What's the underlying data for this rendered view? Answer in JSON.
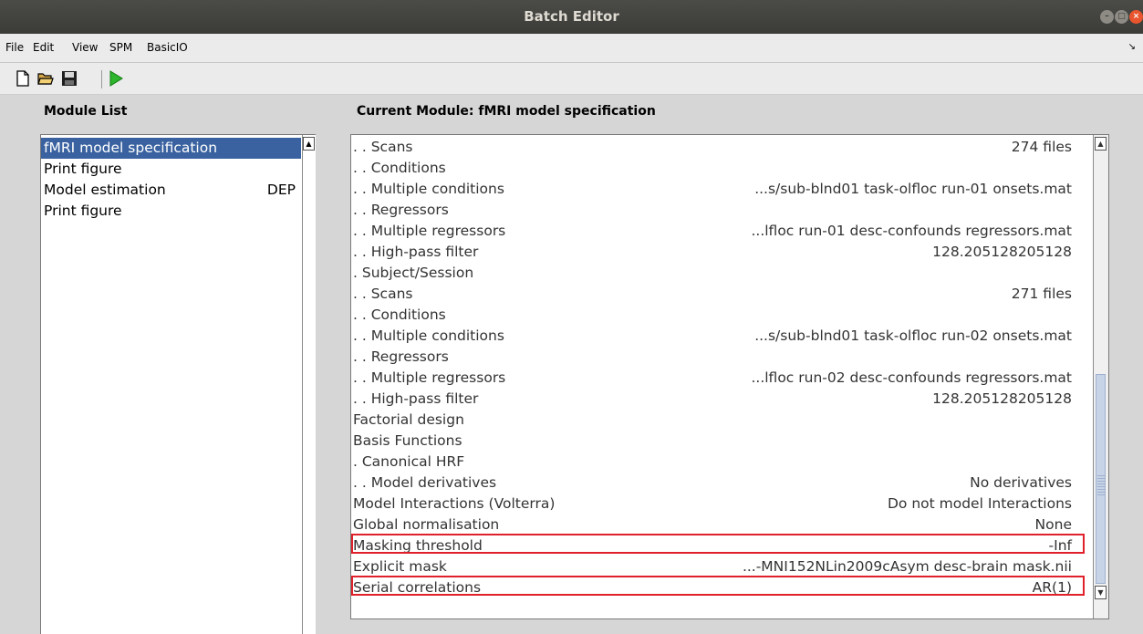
{
  "window": {
    "title": "Batch Editor"
  },
  "menu": {
    "file": "File",
    "edit": "Edit",
    "view": "View",
    "spm": "SPM",
    "basicio": "BasicIO"
  },
  "headers": {
    "module_list": "Module List",
    "current_module": "Current Module: fMRI model specification"
  },
  "module_list": [
    {
      "label": "fMRI model specification",
      "tag": "",
      "selected": true
    },
    {
      "label": "Print figure",
      "tag": ""
    },
    {
      "label": "Model estimation",
      "tag": "DEP"
    },
    {
      "label": "Print figure",
      "tag": ""
    }
  ],
  "current_module": [
    {
      "label": ". . Scans",
      "value": "274 files"
    },
    {
      "label": ". . Conditions",
      "value": ""
    },
    {
      "label": ". . Multiple conditions",
      "value": "...s/sub-blnd01 task-olfloc run-01 onsets.mat"
    },
    {
      "label": ". . Regressors",
      "value": ""
    },
    {
      "label": ". . Multiple regressors",
      "value": "...lfloc run-01 desc-confounds regressors.mat"
    },
    {
      "label": ". . High-pass filter",
      "value": "128.205128205128"
    },
    {
      "label": ". Subject/Session",
      "value": ""
    },
    {
      "label": ". . Scans",
      "value": "271 files"
    },
    {
      "label": ". . Conditions",
      "value": ""
    },
    {
      "label": ". . Multiple conditions",
      "value": "...s/sub-blnd01 task-olfloc run-02 onsets.mat"
    },
    {
      "label": ". . Regressors",
      "value": ""
    },
    {
      "label": ". . Multiple regressors",
      "value": "...lfloc run-02 desc-confounds regressors.mat"
    },
    {
      "label": ". . High-pass filter",
      "value": "128.205128205128"
    },
    {
      "label": "Factorial design",
      "value": ""
    },
    {
      "label": "Basis Functions",
      "value": ""
    },
    {
      "label": ". Canonical HRF",
      "value": ""
    },
    {
      "label": ". . Model derivatives",
      "value": "No derivatives"
    },
    {
      "label": "Model Interactions (Volterra)",
      "value": "Do not model Interactions"
    },
    {
      "label": "Global normalisation",
      "value": "None"
    },
    {
      "label": "Masking threshold",
      "value": "-Inf",
      "highlight": true
    },
    {
      "label": "Explicit mask",
      "value": "...-MNI152NLin2009cAsym desc-brain mask.nii"
    },
    {
      "label": "Serial correlations",
      "value": "AR(1)",
      "highlight": true
    }
  ],
  "icons": {
    "new": "new-file-icon",
    "open": "open-folder-icon",
    "save": "save-icon",
    "run": "run-icon"
  },
  "colors": {
    "selection": "#3a62a0",
    "highlight_box": "#e0202a",
    "run_green": "#2db52d"
  }
}
